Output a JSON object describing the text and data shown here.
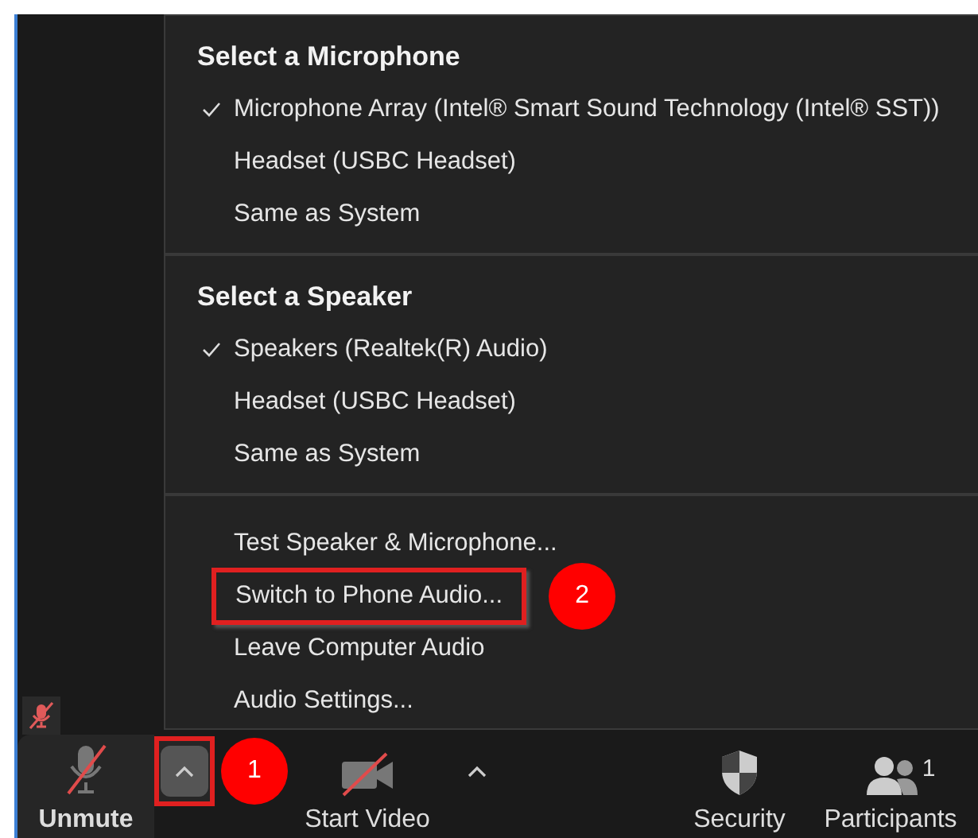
{
  "menu": {
    "sections": [
      {
        "heading": "Select a Microphone",
        "items": [
          {
            "label": "Microphone Array (Intel® Smart Sound Technology (Intel® SST))",
            "checked": true,
            "highlighted": false
          },
          {
            "label": "Headset (USBC Headset)",
            "checked": false,
            "highlighted": false
          },
          {
            "label": "Same as System",
            "checked": false,
            "highlighted": false
          }
        ]
      },
      {
        "heading": "Select a Speaker",
        "items": [
          {
            "label": "Speakers (Realtek(R) Audio)",
            "checked": true,
            "highlighted": false
          },
          {
            "label": "Headset (USBC Headset)",
            "checked": false,
            "highlighted": false
          },
          {
            "label": "Same as System",
            "checked": false,
            "highlighted": false
          }
        ]
      },
      {
        "items": [
          {
            "label": "Test Speaker & Microphone...",
            "checked": false,
            "highlighted": false
          },
          {
            "label": "Switch to Phone Audio...",
            "checked": false,
            "highlighted": true,
            "callout": "2"
          },
          {
            "label": "Leave Computer Audio",
            "checked": false,
            "highlighted": false
          },
          {
            "label": "Audio Settings...",
            "checked": false,
            "highlighted": false
          }
        ]
      }
    ]
  },
  "toolbar": [
    {
      "kind": "mic",
      "label": "Unmute",
      "muted": true,
      "caret": {
        "highlighted": true,
        "callout": "1"
      }
    },
    {
      "kind": "video",
      "label": "Start Video",
      "muted": true,
      "caret": {
        "highlighted": false
      }
    },
    {
      "kind": "security",
      "label": "Security"
    },
    {
      "kind": "participants",
      "label": "Participants",
      "count": "1"
    }
  ]
}
